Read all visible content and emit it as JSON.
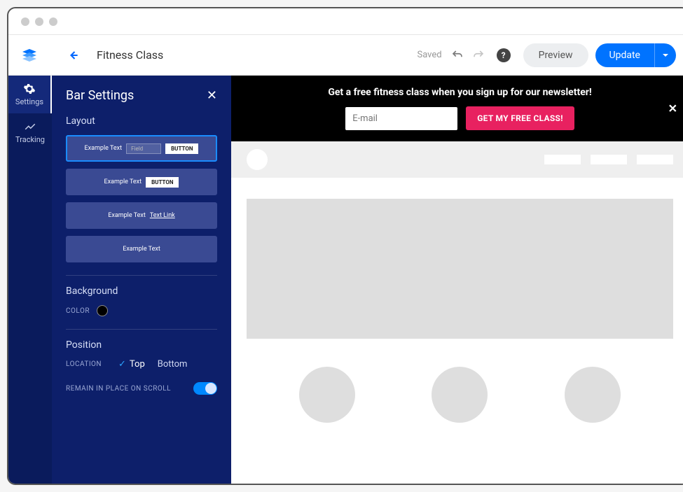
{
  "topnav": {
    "page_title": "Fitness Class",
    "saved_label": "Saved",
    "preview_label": "Preview",
    "update_label": "Update"
  },
  "rail": {
    "settings_label": "Settings",
    "tracking_label": "Tracking"
  },
  "panel": {
    "title": "Bar Settings",
    "layout_label": "Layout",
    "layouts": [
      {
        "ex_text": "Example Text",
        "field_placeholder": "Field",
        "button_label": "BUTTON"
      },
      {
        "ex_text": "Example Text",
        "button_label": "BUTTON"
      },
      {
        "ex_text": "Example Text",
        "link_label": "Text Link"
      },
      {
        "ex_text": "Example Text"
      }
    ],
    "background_label": "Background",
    "color_label": "COLOR",
    "color_value": "#000000",
    "position_label": "Position",
    "location_label": "LOCATION",
    "loc_top": "Top",
    "loc_bottom": "Bottom",
    "remain_label": "REMAIN IN PLACE ON SCROLL"
  },
  "bar": {
    "headline": "Get a free fitness class when you sign up for our newsletter!",
    "email_placeholder": "E-mail",
    "cta_label": "GET MY FREE CLASS!"
  }
}
